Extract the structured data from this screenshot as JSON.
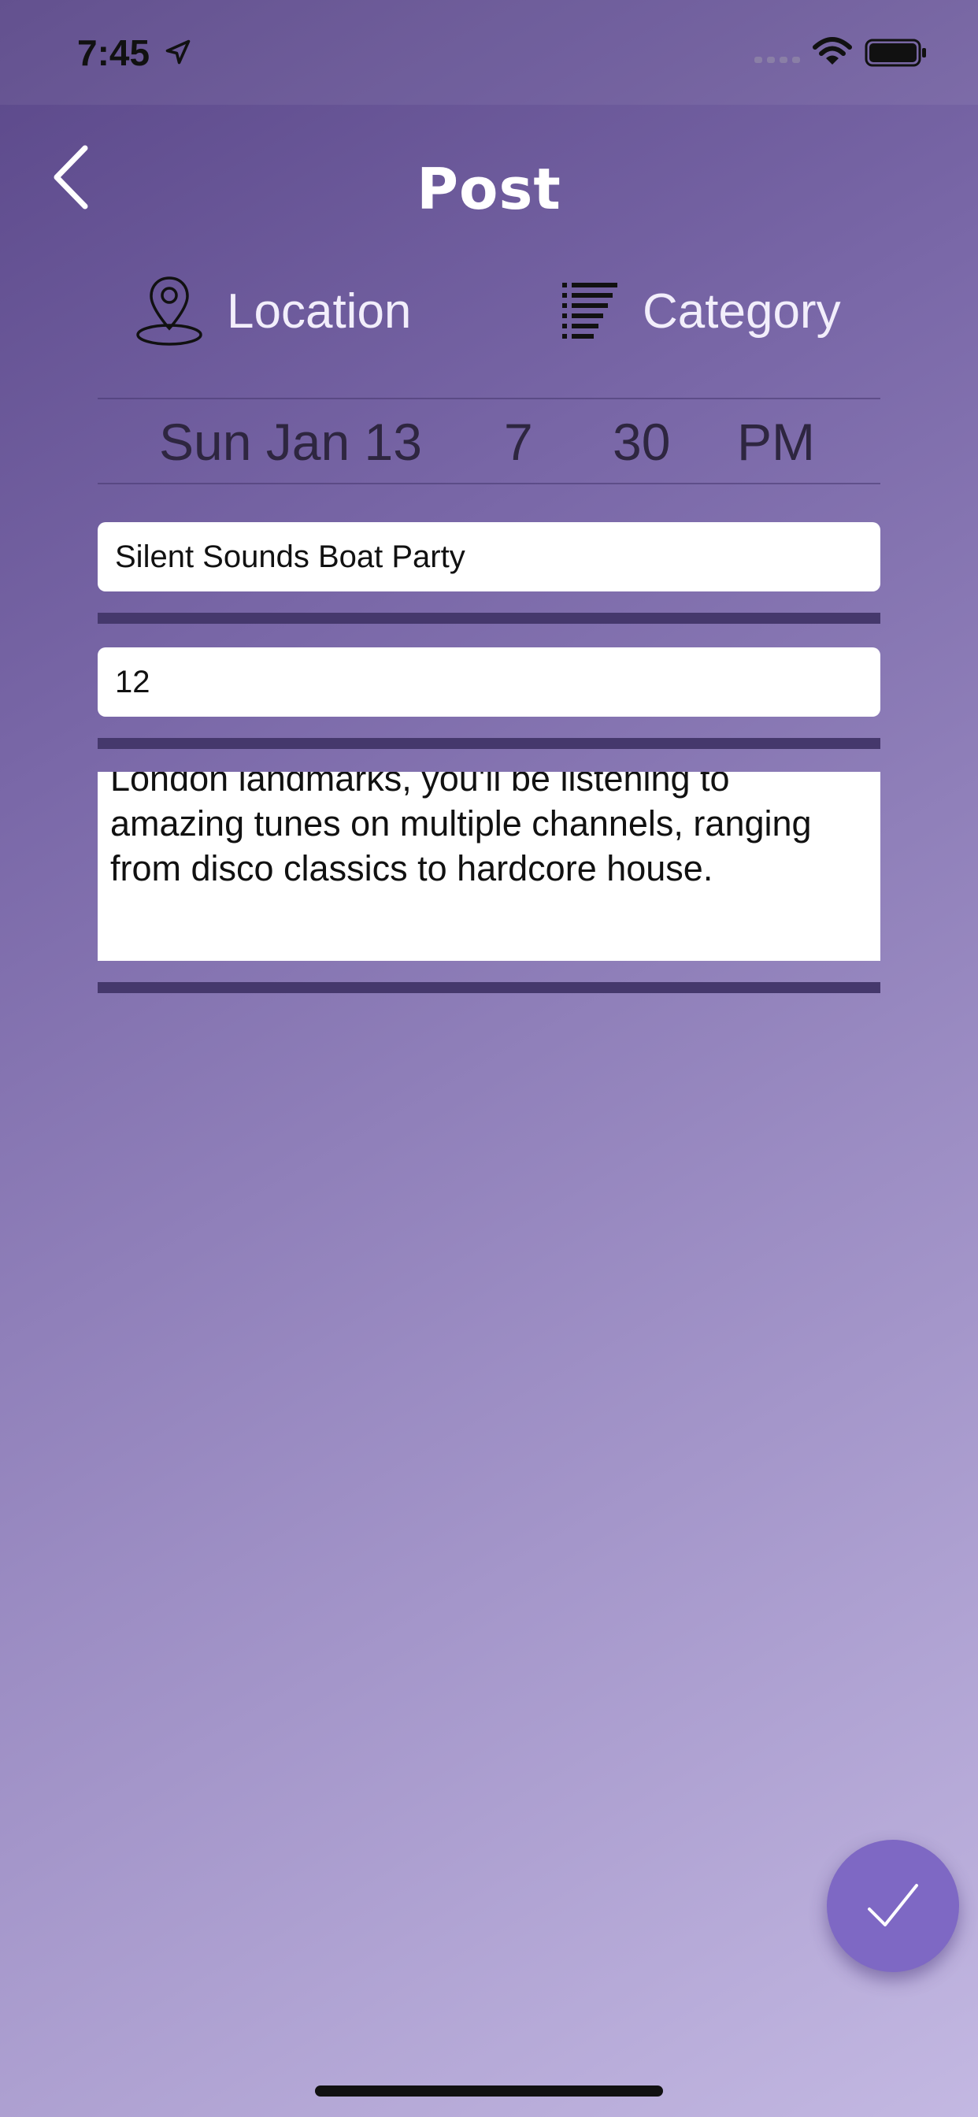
{
  "status_bar": {
    "time": "7:45"
  },
  "header": {
    "title": "Post"
  },
  "options": {
    "location_label": "Location",
    "category_label": "Category"
  },
  "date_picker": {
    "date": "Sun Jan 13",
    "hour": "7",
    "minute": "30",
    "ampm": "PM"
  },
  "form": {
    "title_value": "Silent Sounds Boat Party",
    "number_value": "12",
    "description_value": "London landmarks, you'll be listening to amazing tunes on multiple channels, ranging from disco classics to hardcore house."
  },
  "colors": {
    "accent": "#7e68c4",
    "divider": "#45386c",
    "gradient_start": "#5a4789",
    "gradient_end": "#c3b8e2"
  },
  "icons": {
    "back": "chevron-left-icon",
    "location": "map-pin-icon",
    "category": "list-icon",
    "submit": "checkmark-icon"
  }
}
